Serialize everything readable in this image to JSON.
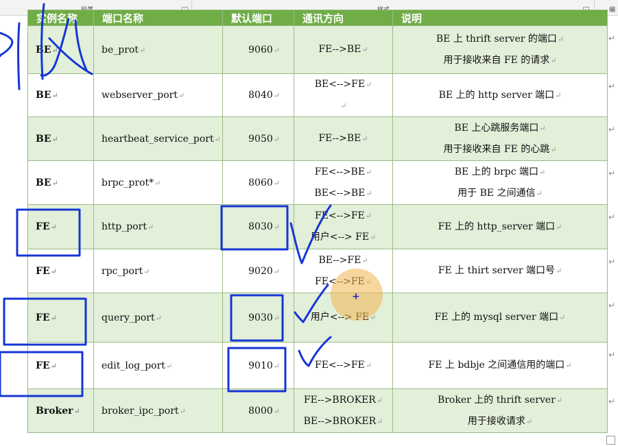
{
  "ribbon": {
    "paragraph_label": "段落",
    "styles_label": "样式",
    "edit_label": "编"
  },
  "table": {
    "headers": [
      "实例名称",
      "端口名称",
      "默认端口",
      "通讯方向",
      "说明"
    ],
    "rows": [
      {
        "instance": "BE",
        "port_name": "be_prot",
        "default_port": "9060",
        "direction": [
          "FE-->BE"
        ],
        "description": [
          "BE 上 thrift server 的端口",
          "用于接收来自 FE  的请求"
        ]
      },
      {
        "instance": "BE",
        "port_name": "webserver_port",
        "default_port": "8040",
        "direction": [
          "BE<-->FE",
          ""
        ],
        "description": [
          "BE 上的 http server 端口"
        ]
      },
      {
        "instance": "BE",
        "port_name": "heartbeat_service_port",
        "default_port": "9050",
        "direction": [
          "FE-->BE"
        ],
        "description": [
          "BE 上心跳服务端口",
          "用于接收来自 FE 的心跳"
        ]
      },
      {
        "instance": "BE",
        "port_name": "brpc_prot*",
        "default_port": "8060",
        "direction": [
          "FE<-->BE",
          "BE<-->BE"
        ],
        "description": [
          "BE 上的 brpc 端口",
          "用于 BE 之间通信"
        ]
      },
      {
        "instance": "FE",
        "port_name": "http_port",
        "default_port": "8030",
        "direction": [
          "FE<-->FE",
          "用户<--> FE"
        ],
        "description": [
          "FE 上的 http_server 端口"
        ]
      },
      {
        "instance": "FE",
        "port_name": "rpc_port",
        "default_port": "9020",
        "direction": [
          "BE-->FE",
          "FE<-->FE"
        ],
        "description": [
          "FE 上 thirt server 端口号"
        ]
      },
      {
        "instance": "FE",
        "port_name": "query_port",
        "default_port": "9030",
        "direction": [
          "用户<--> FE"
        ],
        "description": [
          "FE 上的 mysql server 端口"
        ]
      },
      {
        "instance": "FE",
        "port_name": "edit_log_port",
        "default_port": "9010",
        "direction": [
          "FE<-->FE"
        ],
        "description": [
          "FE 上 bdbje 之间通信用的端口"
        ]
      },
      {
        "instance": "Broker",
        "port_name": "broker_ipc_port",
        "default_port": "8000",
        "direction": [
          "FE-->BROKER",
          "BE-->BROKER"
        ],
        "description": [
          "Broker 上的 thrift server",
          "用于接收请求"
        ]
      }
    ]
  },
  "marks": {
    "paragraph_mark": "↵",
    "launcher": "↘",
    "cursor": "+"
  },
  "colors": {
    "header_green": "#70ad47",
    "row_shade": "#e2efd9",
    "annotation_blue": "#1535d6",
    "cursor_halo": "#f0b450"
  }
}
